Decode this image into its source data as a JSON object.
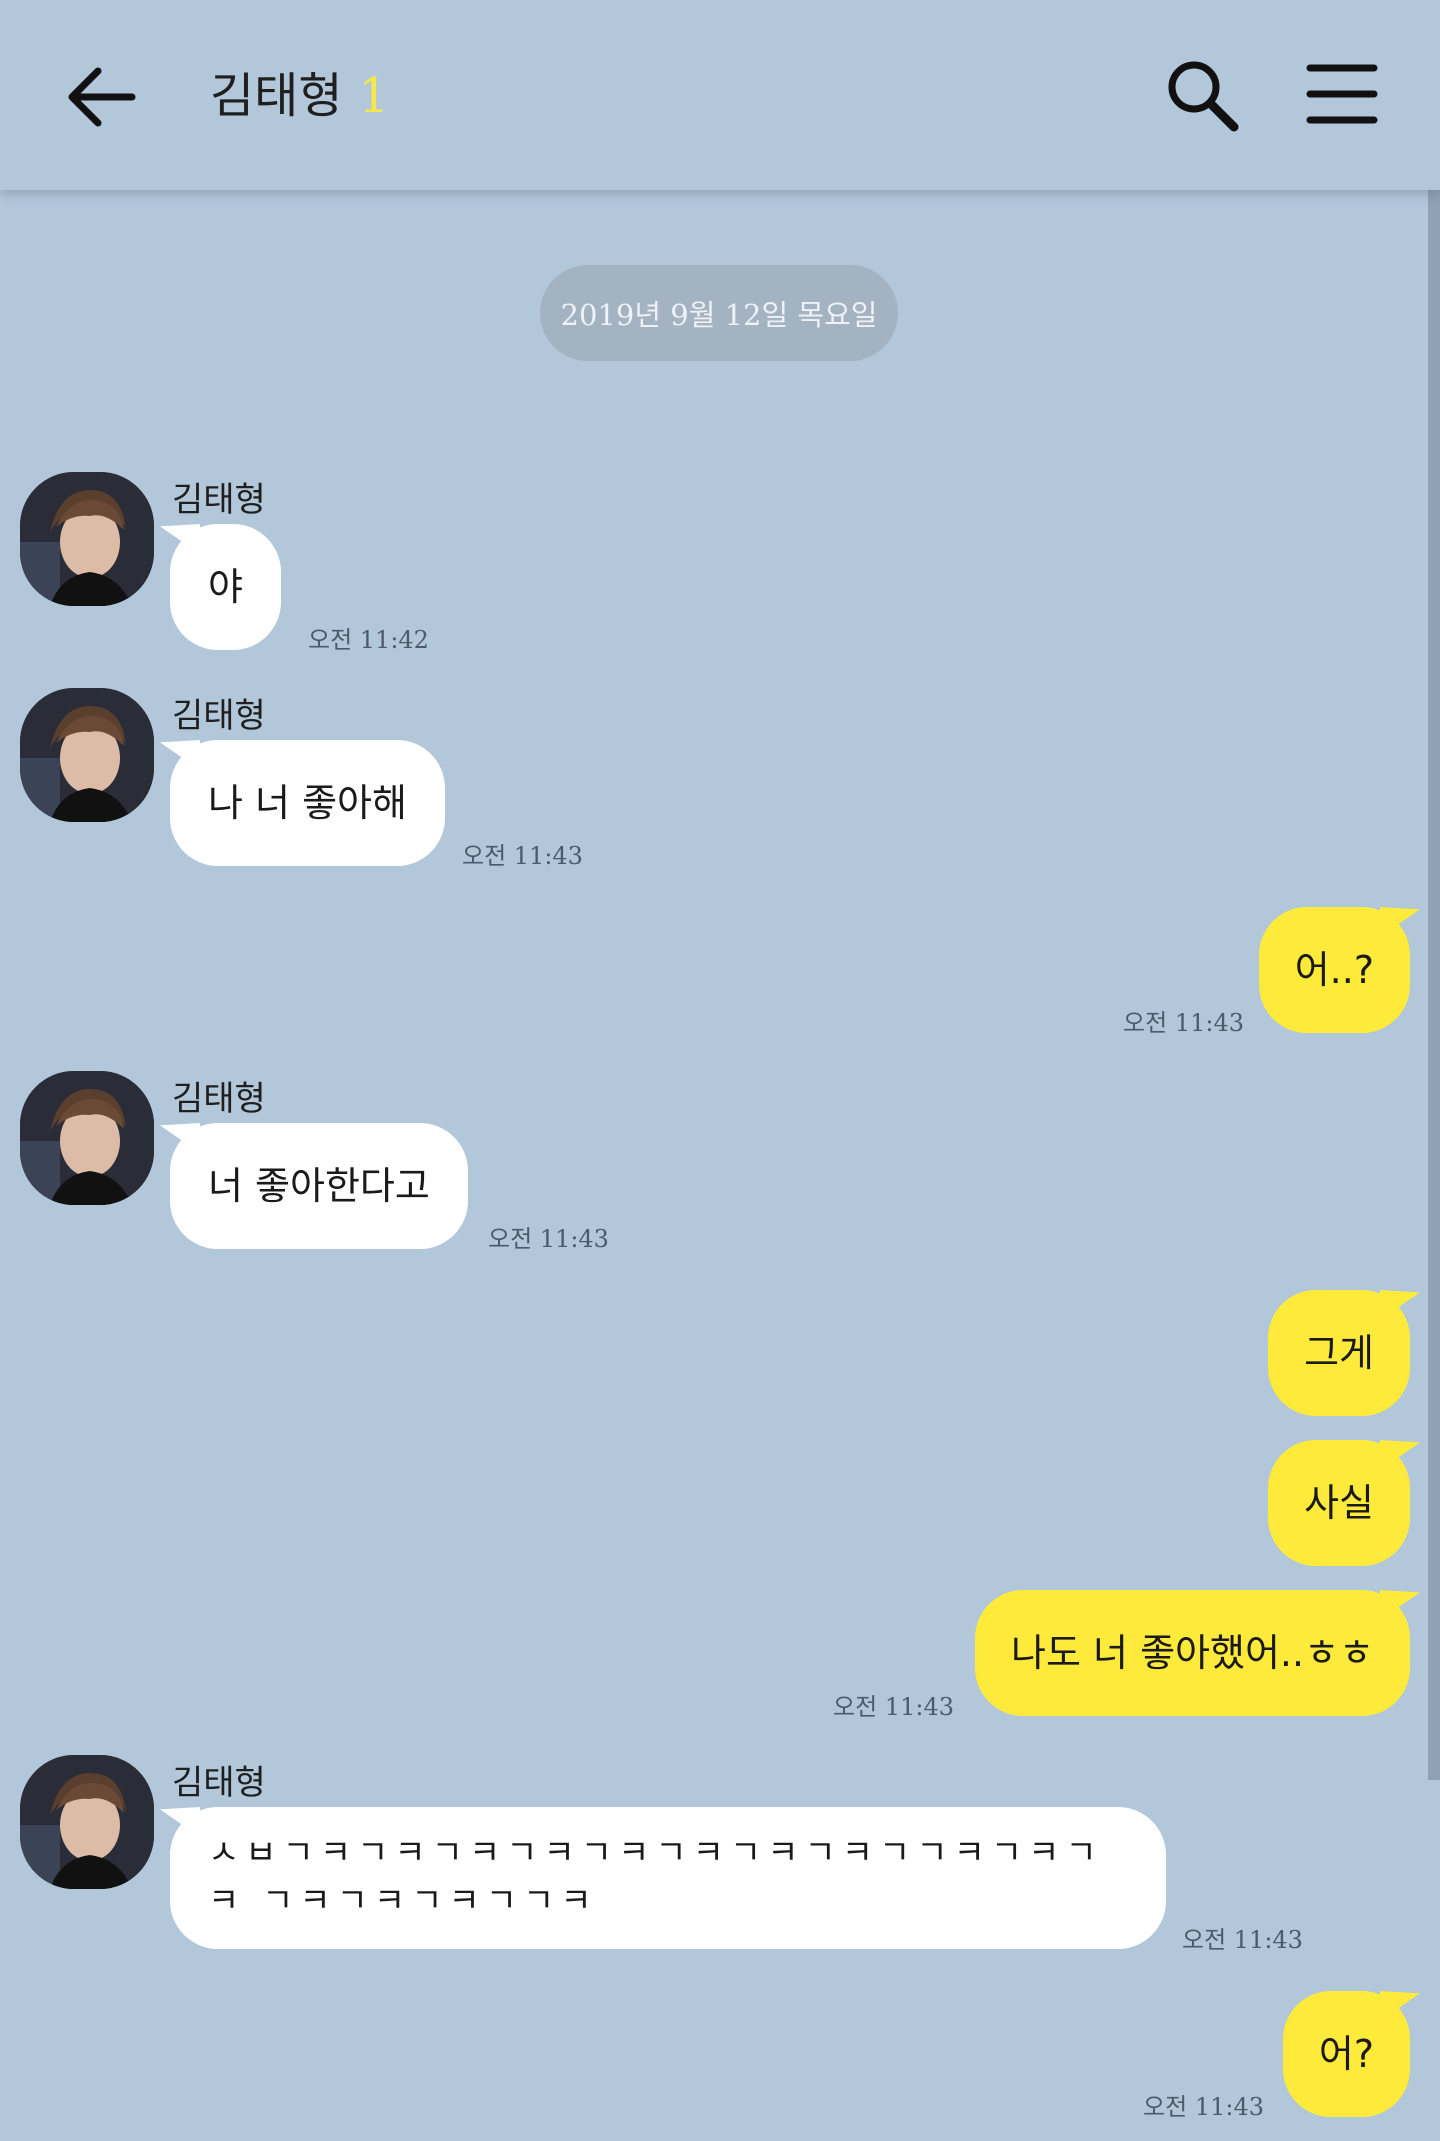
{
  "header": {
    "contact_name": "김태형",
    "unread_count": "1"
  },
  "date_divider": "2019년 9월 12일 목요일",
  "messages": [
    {
      "sender": "김태형",
      "text": "야",
      "time": "오전 11:42"
    },
    {
      "sender": "김태형",
      "text": "나 너 좋아해",
      "time": "오전 11:43"
    },
    {
      "text": "어..?",
      "time": "오전 11:43"
    },
    {
      "sender": "김태형",
      "text": "너 좋아한다고",
      "time": "오전 11:43"
    },
    {
      "text": "그게"
    },
    {
      "text": "사실"
    },
    {
      "text": "나도 너 좋아했어..ㅎㅎ",
      "time": "오전 11:43"
    },
    {
      "sender": "김태형",
      "text": "ㅅㅂㄱㅋㄱㅋㄱㅋㄱㅋㄱㅋㄱㅋㄱㅋㄱㅋㄱㄱㅋㄱㅋㄱㅋ ㄱㅋㄱㅋㄱㅋㄱㄱㅋ",
      "time": "오전 11:43"
    },
    {
      "text": "어?",
      "time": "오전 11:43"
    }
  ],
  "colors": {
    "background": "#b2c7da",
    "incoming_bubble": "#ffffff",
    "outgoing_bubble": "#fdea3a",
    "unread_count": "#f6e84a"
  },
  "icons": {
    "back": "arrow-left-icon",
    "search": "search-icon",
    "menu": "hamburger-menu-icon"
  }
}
